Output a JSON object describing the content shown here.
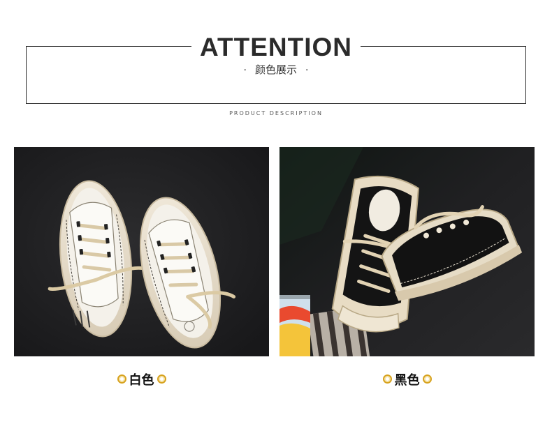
{
  "header": {
    "title": "ATTENTION",
    "subtitle": "颜色展示",
    "subtitle_dot": "·",
    "description": "PRODUCT DESCRIPTION"
  },
  "products": [
    {
      "color_label": "白色",
      "photo": "white-canvas-sneakers-photo"
    },
    {
      "color_label": "黑色",
      "photo": "black-canvas-sneakers-photo"
    }
  ],
  "colors": {
    "accent_ring": "#d7a21e",
    "frame": "#2b2b2b",
    "photo_background": "#1f1f21"
  }
}
